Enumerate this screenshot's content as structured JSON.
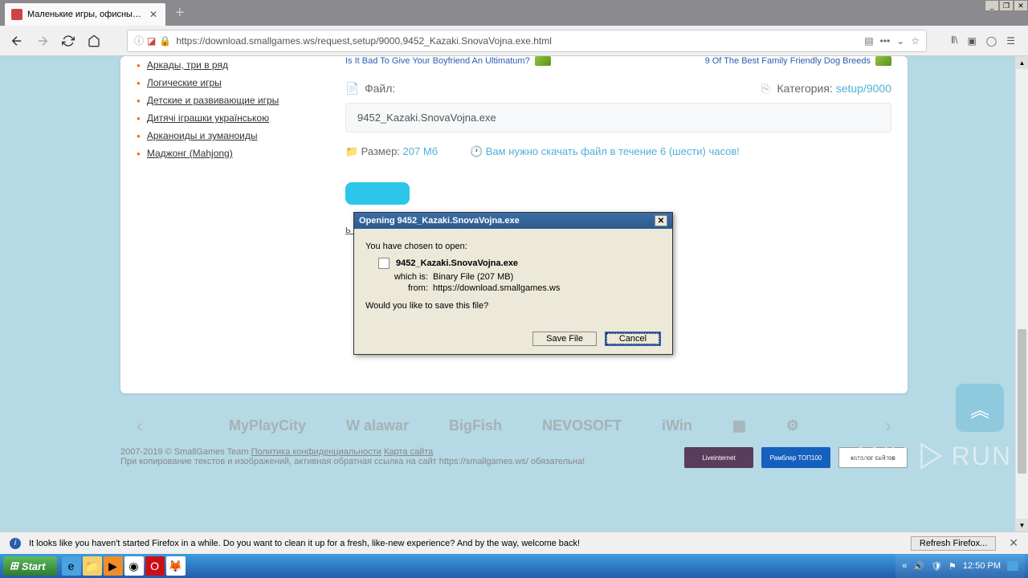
{
  "tab": {
    "title": "Маленькие игры, офисные игры"
  },
  "url": "https://download.smallgames.ws/request,setup/9000,9452_Kazaki.SnovaVojna.exe.html",
  "sidebar": {
    "items": [
      "Аркады, три в ряд",
      "Логические игры",
      "Детские и развивающие игры",
      "Дитячі іграшки українською",
      "Арканоиды и зуманоиды",
      "Маджонг (Mahjong)"
    ]
  },
  "ads": {
    "left": "Is It Bad To Give Your Boyfriend An Ultimatum?",
    "right": "9 Of The Best Family Friendly Dog Breeds"
  },
  "file": {
    "label": "Файл:",
    "category_label": "Категория:",
    "category_link": "setup/9000",
    "name": "9452_Kazaki.SnovaVojna.exe",
    "size_label": "Размер:",
    "size_value": "207 Мб",
    "timer_text": "Вам нужно скачать файл в течение 6 (шести) часов!",
    "alt_hint": "ь файл"
  },
  "dialog": {
    "title": "Opening 9452_Kazaki.SnovaVojna.exe",
    "chosen": "You have chosen to open:",
    "filename": "9452_Kazaki.SnovaVojna.exe",
    "which_lbl": "which is:",
    "which_val": "Binary File (207 MB)",
    "from_lbl": "from:",
    "from_val": "https://download.smallgames.ws",
    "prompt": "Would you like to save this file?",
    "save": "Save File",
    "cancel": "Cancel"
  },
  "footer": {
    "copy": "2007-2019 © SmallGames Team",
    "privacy": "Политика конфиденциальности",
    "sitemap": "Карта сайта",
    "note": "При копирование текстов и изображений, активная обратная ссылка на сайт https://smallgames.ws/ обязательна!",
    "badges": [
      "Liveinternet",
      "Рамблер ТОП100",
      "каталог сайтов"
    ]
  },
  "logos": [
    "MyPlayCity",
    "W alawar",
    "BigFish",
    "NEVOSOFT",
    "iWin",
    "▦",
    "⚙"
  ],
  "notif": {
    "text": "It looks like you haven't started Firefox in a while. Do you want to clean it up for a fresh, like-new experience? And by the way, welcome back!",
    "btn": "Refresh Firefox..."
  },
  "taskbar": {
    "start": "Start",
    "time": "12:50 PM"
  },
  "watermark": "ANY"
}
